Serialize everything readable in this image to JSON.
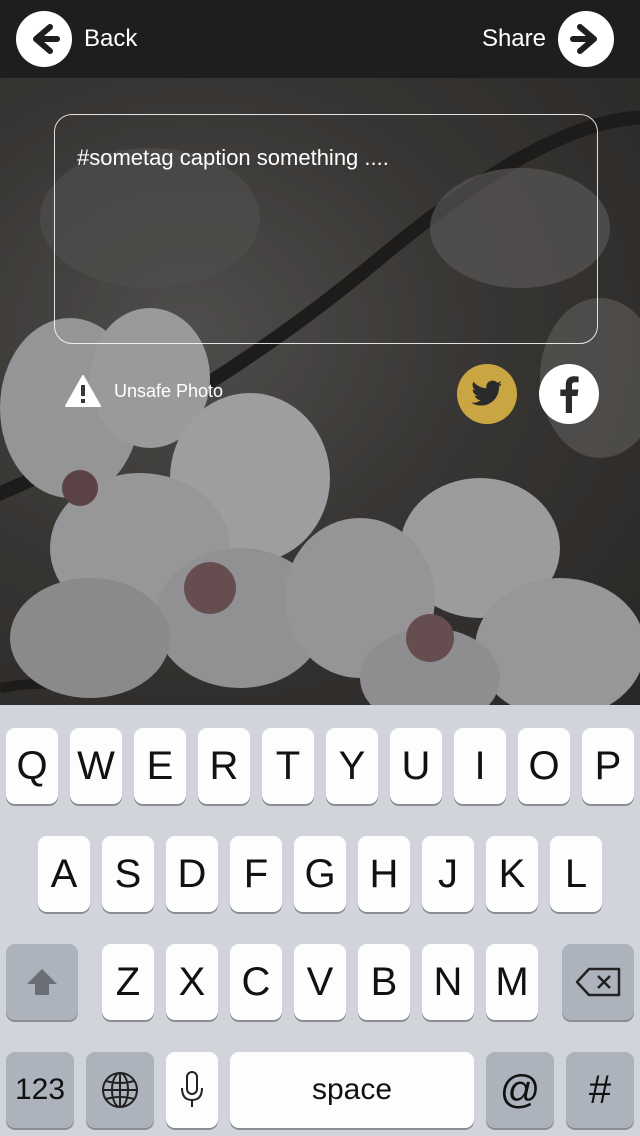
{
  "nav": {
    "back_label": "Back",
    "share_label": "Share"
  },
  "caption": {
    "text": "#sometag caption something ...."
  },
  "warning": {
    "label": "Unsafe Photo"
  },
  "social": {
    "twitter_color": "#c9a642",
    "facebook_color": "#ffffff"
  },
  "keyboard": {
    "row1": [
      "Q",
      "W",
      "E",
      "R",
      "T",
      "Y",
      "U",
      "I",
      "O",
      "P"
    ],
    "row2": [
      "A",
      "S",
      "D",
      "F",
      "G",
      "H",
      "J",
      "K",
      "L"
    ],
    "row3": [
      "Z",
      "X",
      "C",
      "V",
      "B",
      "N",
      "M"
    ],
    "numbers_label": "123",
    "space_label": "space",
    "at_label": "@",
    "hash_label": "#"
  },
  "colors": {
    "navbar": "#1e1e1e",
    "keyboard_bg": "#d1d5db",
    "accent": "#c9a642"
  }
}
